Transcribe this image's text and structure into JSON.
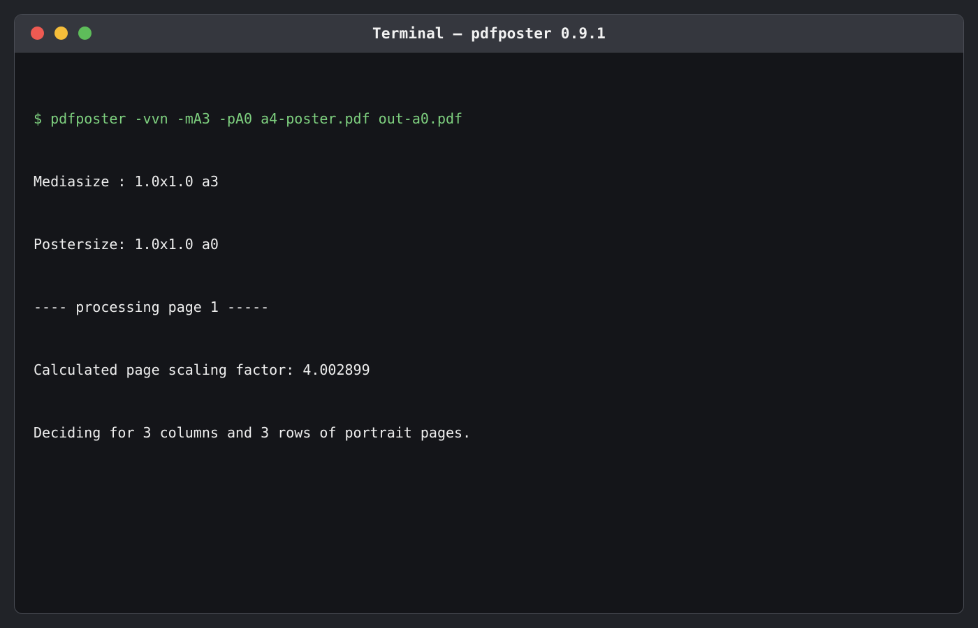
{
  "window": {
    "title": "Terminal — pdfposter 0.9.1",
    "traffic_lights": {
      "close": "#ee5a52",
      "minimize": "#f5bd3a",
      "maximize": "#5ebd5a"
    }
  },
  "terminal": {
    "command": "$ pdfposter -vvn -mA3 -pA0 a4-poster.pdf out-a0.pdf",
    "output": [
      "Mediasize : 1.0x1.0 a3",
      "Postersize: 1.0x1.0 a0",
      "---- processing page 1 -----",
      "Calculated page scaling factor: 4.002899",
      "Deciding for 3 columns and 3 rows of portrait pages."
    ],
    "colors": {
      "background": "#141519",
      "command": "#7ed07f",
      "text": "#eeeeee"
    }
  }
}
